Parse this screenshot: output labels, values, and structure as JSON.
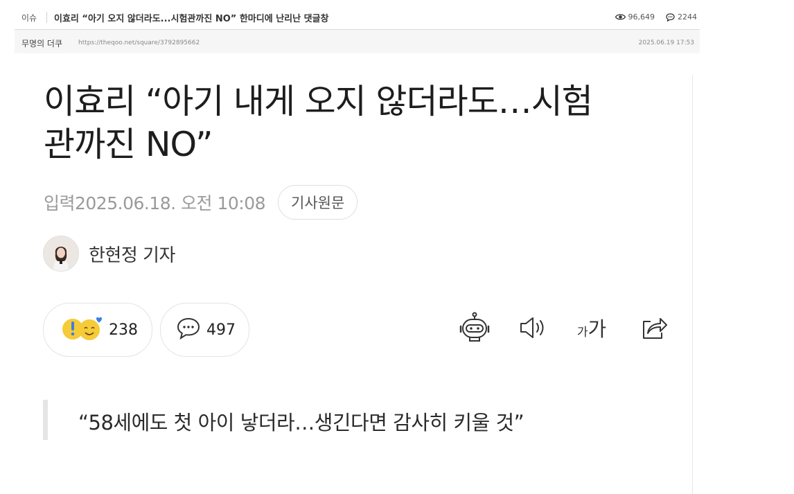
{
  "post": {
    "category": "이슈",
    "title": "이효리 “아기 오지 않더라도...시험관까진 NO” 한마디에 난리난 댓글창",
    "views": "96,649",
    "comments": "2244",
    "author": "무명의 더쿠",
    "url": "https://theqoo.net/square/3792895662",
    "date": "2025.06.19 17:53"
  },
  "article": {
    "headline_line1": "이효리 “아기 내게 오지 않더라도…시험",
    "headline_line2": "관까진 NO”",
    "published": "입력2025.06.18. 오전 10:08",
    "original_button": "기사원문",
    "reporter": "한현정 기자",
    "reaction_count": "238",
    "comment_count": "497",
    "font_size_icon_text": "가가",
    "quote": "“58세에도 첫 아이 낳더라…생긴다면 감사히 키울 것”"
  },
  "icons": {
    "views": "eye-icon",
    "comments": "speech-bubble-icon",
    "summary": "robot-icon",
    "read_aloud": "speaker-icon",
    "font_size": "font-size-icon",
    "share": "share-icon"
  },
  "colors": {
    "reaction_yellow": "#f6cb38",
    "reaction_blue": "#3b7fe0"
  }
}
